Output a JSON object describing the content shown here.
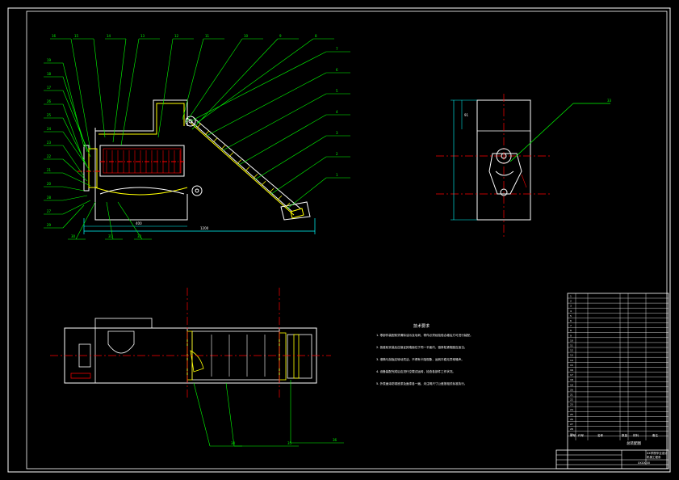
{
  "drawing": {
    "background": "#000000",
    "line_colors": {
      "frame": "#ffffff",
      "part": "#ffffff",
      "leader": "#00ff00",
      "center": "#ff0000",
      "hidden": "#ffff00",
      "dimension": "#00ffff"
    }
  },
  "callouts": {
    "front_top": [
      "16",
      "15",
      "14",
      "13",
      "12",
      "11",
      "10",
      "9",
      "8"
    ],
    "front_left": [
      "19",
      "18",
      "17",
      "26",
      "25",
      "24",
      "23",
      "22",
      "21",
      "20",
      "28",
      "27",
      "29"
    ],
    "front_right": [
      "7",
      "6",
      "5",
      "4",
      "3",
      "2",
      "1"
    ],
    "front_bottom": [
      "30",
      "31",
      "32"
    ],
    "side_view": "33",
    "plan_bottom": [
      "34",
      "35",
      "36"
    ]
  },
  "dimensions": {
    "front_length": "1200",
    "front_width": "400",
    "side_height": "91"
  },
  "technical_requirements": {
    "title": "技术要求",
    "items": [
      "1. 零部件装配前须清除油污及毛刺，零件必须经检验合格后方可进行装配。",
      "2. 各链轮安装后应保证其端面位于同一平面内，链条松紧程度应适当。",
      "3. 滚筒与刮板应转动灵活，不得有卡阻现象，运转平稳无异常噪声。",
      "4. 设备装配完成后应进行空载试运转，检查各部件工作状况。",
      "5. 外表面涂防锈底漆及面漆各一遍，未注明尺寸公差按相关标准执行。"
    ]
  },
  "title_block": {
    "drawing_title": "总装配图",
    "company_lines": [
      "XX学院毕业设计",
      "机械工程系"
    ],
    "columns": [
      "序号",
      "代号",
      "名称",
      "数量",
      "材料",
      "备注"
    ],
    "drawing_number": "XXXX-00"
  }
}
